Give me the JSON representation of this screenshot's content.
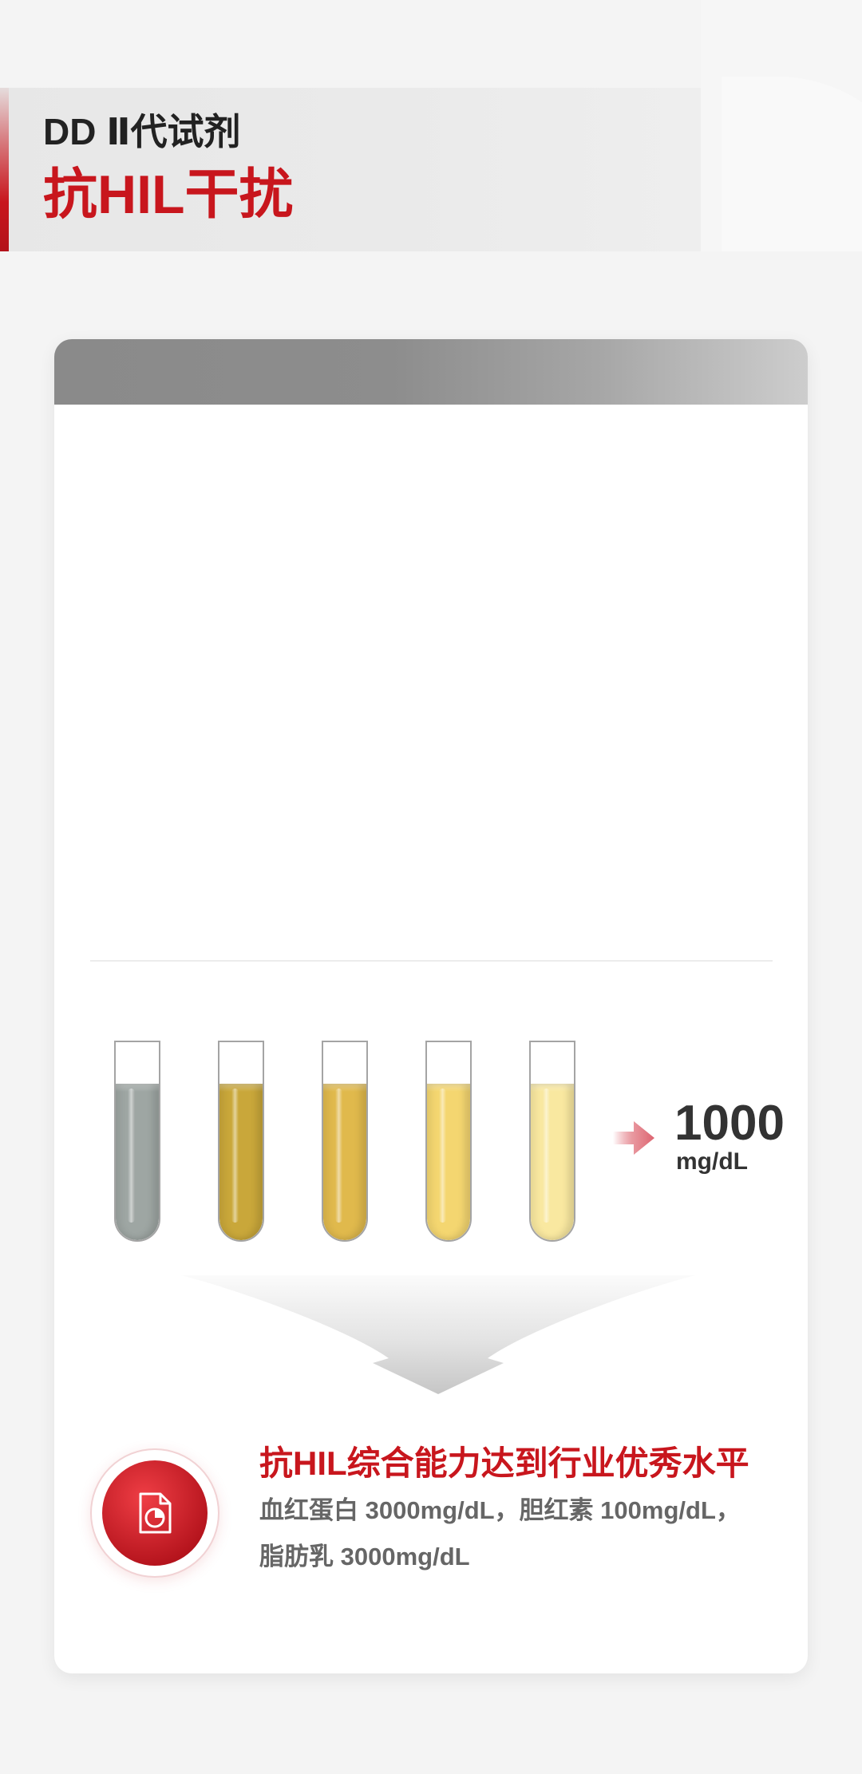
{
  "header": {
    "subtitle": "DD Ⅱ代试剂",
    "title": "抗HIL干扰"
  },
  "colors": {
    "accent_red": "#c8161d",
    "text_dark": "#222222",
    "text_gray": "#666666",
    "card_header_gray": "#8b8b8b",
    "arrow_pink": "#e4808a"
  },
  "tubes": [
    {
      "liquid_color": "#9ea6a3"
    },
    {
      "liquid_color": "#c9a73a"
    },
    {
      "liquid_color": "#e0b94c"
    },
    {
      "liquid_color": "#f4d670"
    },
    {
      "liquid_color": "#f9e8a0"
    }
  ],
  "concentration": {
    "icon": "arrow-right-icon",
    "value": "1000",
    "unit": "mg/dL"
  },
  "funnel_icon": "down-funnel-arrow-icon",
  "conclusion": {
    "icon": "report-pie-chart-icon",
    "title": "抗HIL综合能力达到行业优秀水平",
    "line1": "血红蛋白 3000mg/dL，胆红素 100mg/dL，",
    "line2": "脂肪乳 3000mg/dL"
  }
}
